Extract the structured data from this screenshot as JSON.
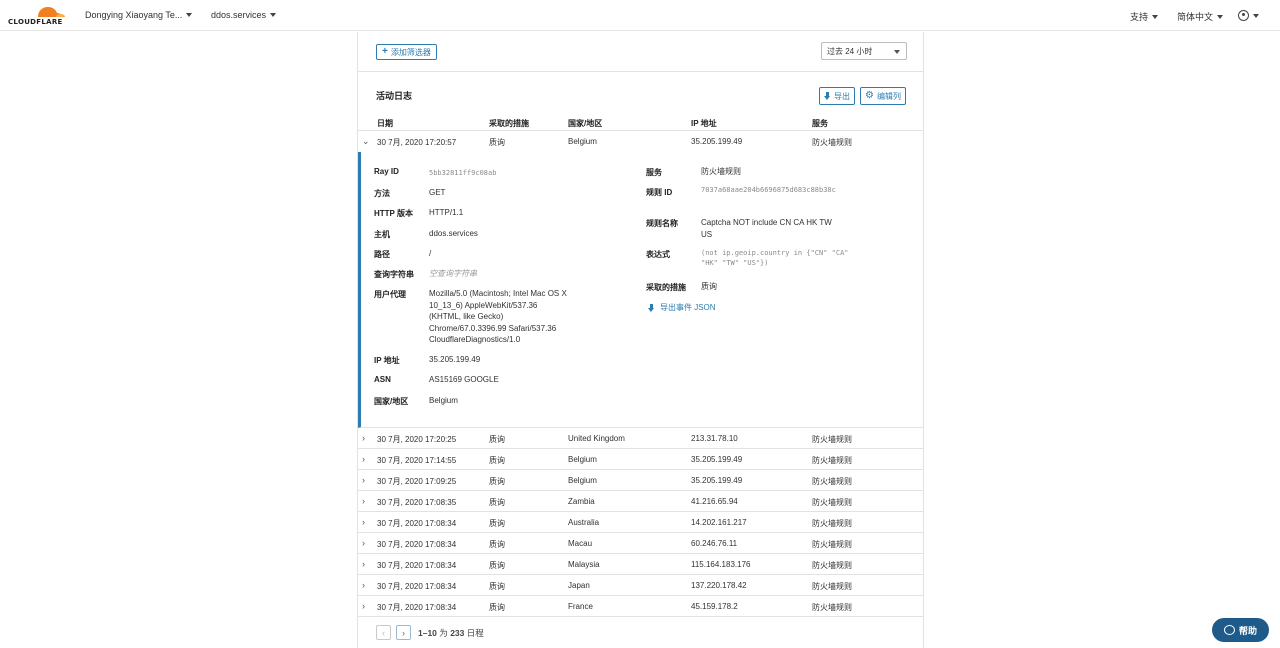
{
  "header": {
    "logo_text": "CLOUDFLARE",
    "account": "Dongying Xiaoyang Te...",
    "zone": "ddos.services",
    "support": "支持",
    "language": "简体中文",
    "brand_color": "#f38020"
  },
  "filters": {
    "add_filter": "添加筛选器",
    "time_range": "过去 24 小时"
  },
  "log": {
    "title": "活动日志",
    "export_label": "导出",
    "columns_label": "编辑列",
    "columns": [
      "日期",
      "采取的措施",
      "国家/地区",
      "IP 地址",
      "服务"
    ],
    "expanded": {
      "date": "30 7月, 2020 17:20:57",
      "action": "质询",
      "country": "Belgium",
      "ip": "35.205.199.49",
      "service": "防火墙规则"
    },
    "rows": [
      {
        "date": "30 7月, 2020 17:20:25",
        "action": "质询",
        "country": "United Kingdom",
        "ip": "213.31.78.10",
        "service": "防火墙规则"
      },
      {
        "date": "30 7月, 2020 17:14:55",
        "action": "质询",
        "country": "Belgium",
        "ip": "35.205.199.49",
        "service": "防火墙规则"
      },
      {
        "date": "30 7月, 2020 17:09:25",
        "action": "质询",
        "country": "Belgium",
        "ip": "35.205.199.49",
        "service": "防火墙规则"
      },
      {
        "date": "30 7月, 2020 17:08:35",
        "action": "质询",
        "country": "Zambia",
        "ip": "41.216.65.94",
        "service": "防火墙规则"
      },
      {
        "date": "30 7月, 2020 17:08:34",
        "action": "质询",
        "country": "Australia",
        "ip": "14.202.161.217",
        "service": "防火墙规则"
      },
      {
        "date": "30 7月, 2020 17:08:34",
        "action": "质询",
        "country": "Macau",
        "ip": "60.246.76.11",
        "service": "防火墙规则"
      },
      {
        "date": "30 7月, 2020 17:08:34",
        "action": "质询",
        "country": "Malaysia",
        "ip": "115.164.183.176",
        "service": "防火墙规则"
      },
      {
        "date": "30 7月, 2020 17:08:34",
        "action": "质询",
        "country": "Japan",
        "ip": "137.220.178.42",
        "service": "防火墙规则"
      },
      {
        "date": "30 7月, 2020 17:08:34",
        "action": "质询",
        "country": "France",
        "ip": "45.159.178.2",
        "service": "防火墙规则"
      }
    ]
  },
  "detail": {
    "left": [
      {
        "key": "Ray ID",
        "value": "5bb32811ff9c08ab"
      },
      {
        "key": "方法",
        "value": "GET"
      },
      {
        "key": "HTTP 版本",
        "value": "HTTP/1.1"
      },
      {
        "key": "主机",
        "value": "ddos.services"
      },
      {
        "key": "路径",
        "value": "/"
      },
      {
        "key": "查询字符串",
        "value": "空查询字符串"
      },
      {
        "key": "用户代理",
        "value": "Mozilla/5.0 (Macintosh; Intel Mac OS X 10_13_6) AppleWebKit/537.36 (KHTML, like Gecko) Chrome/67.0.3396.99 Safari/537.36 CloudflareDiagnostics/1.0"
      },
      {
        "key": "IP 地址",
        "value": "35.205.199.49"
      },
      {
        "key": "ASN",
        "value": "AS15169 GOOGLE"
      },
      {
        "key": "国家/地区",
        "value": "Belgium"
      }
    ],
    "right": [
      {
        "key": "服务",
        "value": "防火墙规则"
      },
      {
        "key": "规则 ID",
        "value": "7037a68aae204b6696875d683c88b38c"
      },
      {
        "key": "规则名称",
        "value": "Captcha NOT include CN CA HK TW US"
      },
      {
        "key": "表达式",
        "value": "(not ip.geoip.country in {\"CN\" \"CA\" \"HK\" \"TW\" \"US\"})"
      },
      {
        "key": "采取的措施",
        "value": "质询"
      }
    ],
    "export_json": "导出事件 JSON"
  },
  "pager": {
    "range": "1–10",
    "of": "为",
    "total": "233",
    "unit": "日程"
  },
  "help": {
    "label": "帮助"
  }
}
